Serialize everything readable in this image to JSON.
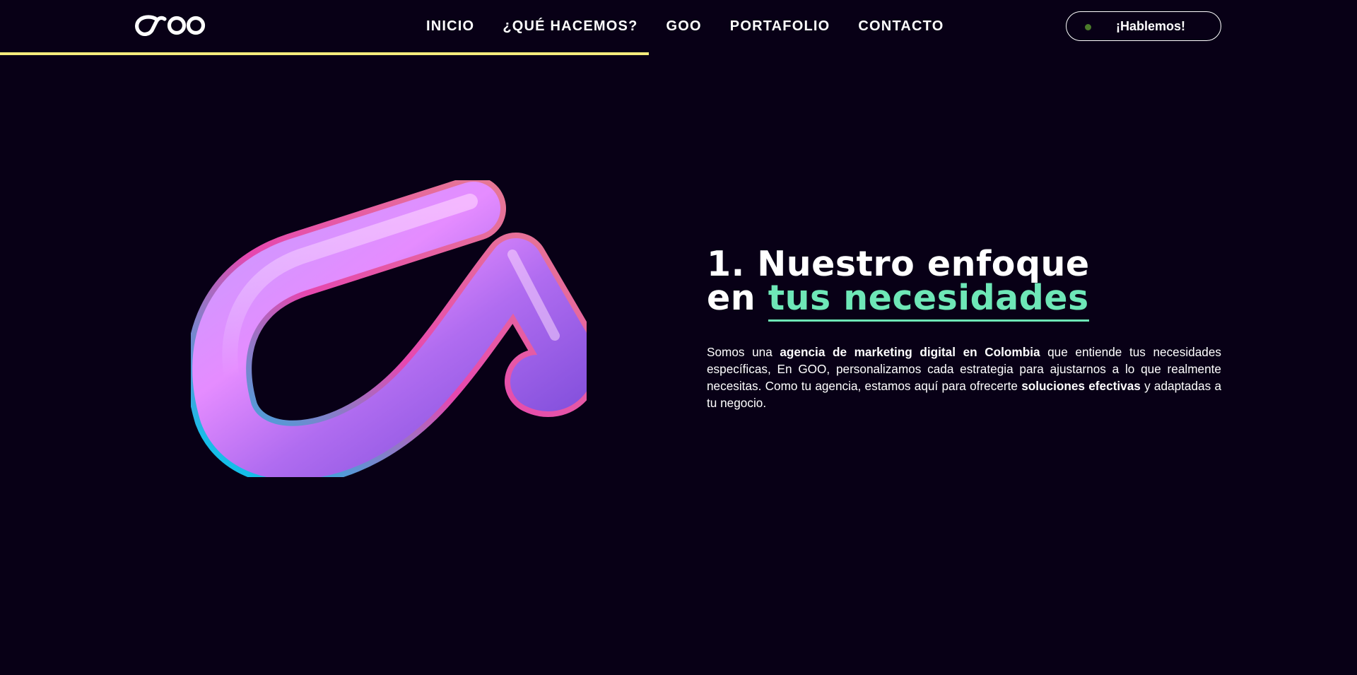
{
  "colors": {
    "background": "#080016",
    "text": "#ffffff",
    "accent_green": "#6ee7b7",
    "progress_yellow": "#f4ec7c",
    "cta_dot": "#4a7a2a"
  },
  "header": {
    "logo_text": "GOO",
    "nav": [
      {
        "label": "INICIO"
      },
      {
        "label": "¿QUÉ HACEMOS?"
      },
      {
        "label": "GOO"
      },
      {
        "label": "PORTAFOLIO"
      },
      {
        "label": "CONTACTO"
      }
    ],
    "cta_label": "¡Hablemos!",
    "scroll_progress": 0.478
  },
  "hero": {
    "shape_icon": "iridescent-3d-arrow-shape"
  },
  "section": {
    "heading_line1": "1. Nuestro enfoque",
    "heading_prefix": "en",
    "heading_highlight": "tus necesidades",
    "body": {
      "p1": "Somos una ",
      "b1": "agencia de marketing digital en Colombia",
      "p2": " que entiende tus necesidades específicas, En GOO, personalizamos cada estrategia para ajustarnos a lo que realmente necesitas. Como tu agencia, estamos aquí para ofrecerte ",
      "b2": "soluciones efectivas",
      "p3": " y adaptadas a tu negocio."
    }
  }
}
